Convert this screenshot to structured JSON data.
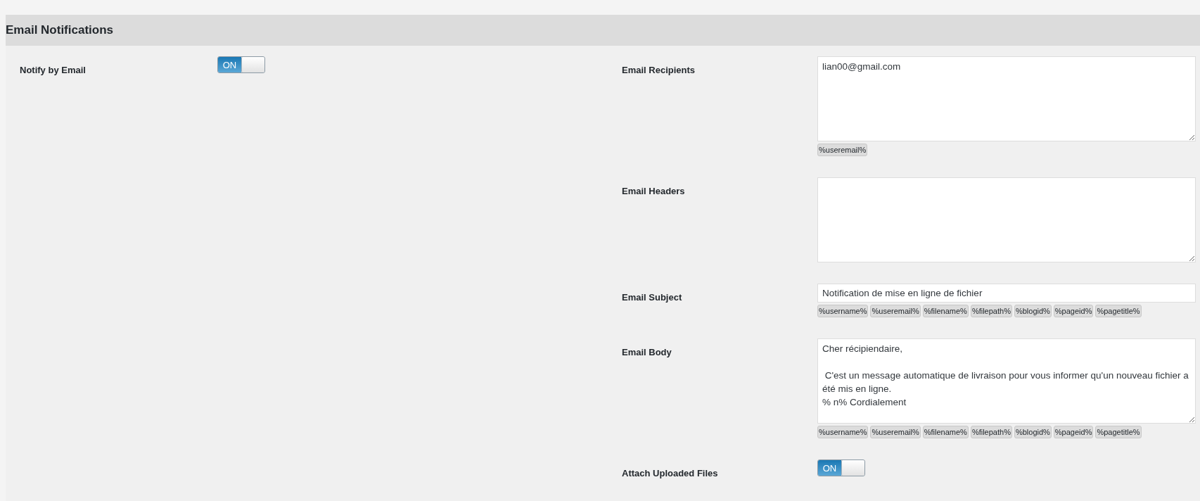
{
  "section": {
    "title": "Email Notifications"
  },
  "left_fields": [
    {
      "kind": "toggle",
      "label": "Notify by Email",
      "toggle": {
        "text": "ON",
        "on": true
      }
    }
  ],
  "right_fields": [
    {
      "kind": "textarea",
      "label": "Email Recipients",
      "value": "lian00@gmail.com",
      "tags": [
        "%useremail%"
      ]
    },
    {
      "kind": "textarea",
      "label": "Email Headers"
    },
    {
      "kind": "input",
      "label": "Email Subject",
      "value": "Notification de mise en ligne de fichier",
      "tags": [
        "%username%",
        "%useremail%",
        "%filename%",
        "%filepath%",
        "%blogid%",
        "%pageid%",
        "%pagetitle%"
      ]
    },
    {
      "kind": "textarea",
      "label": "Email Body",
      "value": "Cher récipiendaire,\n\n C'est un message automatique de livraison pour vous informer qu'un nouveau fichier a été mis en ligne.\n% n% Cordialement",
      "tags": [
        "%username%",
        "%useremail%",
        "%filename%",
        "%filepath%",
        "%blogid%",
        "%pageid%",
        "%pagetitle%"
      ]
    },
    {
      "kind": "toggle",
      "label": "Attach Uploaded Files",
      "toggle": {
        "text": "ON",
        "on": true
      }
    }
  ]
}
